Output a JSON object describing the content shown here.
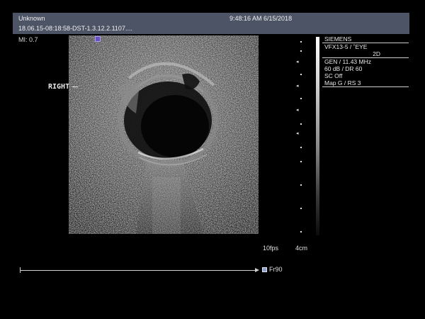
{
  "header": {
    "patient_name": "Unknown",
    "datetime": "9:48:16 AM 6/15/2018",
    "study_id": "18.06.15-08:18:58-DST-1.3.12.2.1107...."
  },
  "mi": "MI: 0.7",
  "body_marker": "RIGHT",
  "info_panel": {
    "vendor": "SIEMENS",
    "transducer": "VFX13-5 / ˚EYE",
    "mode": "2D",
    "frequency": "GEN / 11.43 MHz",
    "gain": "60 dB / DR 60",
    "sc": "SC Off",
    "map": "Map G / RS 3"
  },
  "depth_scale": {
    "major_mark_glyph": "◂"
  },
  "frame_rate": "10fps",
  "depth": "4cm",
  "cine": {
    "frame_label": "Fr90"
  },
  "colors": {
    "header_bg": "#4d5466",
    "text": "#e6e6e6",
    "roi_marker": "#6a4fc0"
  }
}
